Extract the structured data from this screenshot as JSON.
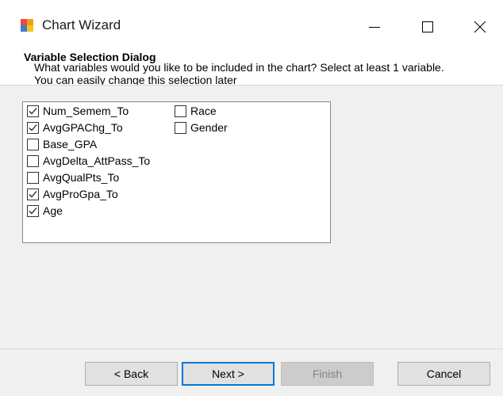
{
  "window": {
    "title": "Chart Wizard",
    "icons": {
      "app": "chart-app-icon",
      "minimize": "minimize-icon",
      "maximize": "maximize-icon",
      "close": "close-icon"
    }
  },
  "header": {
    "title": "Variable Selection Dialog",
    "description": "What variables would you like to be included in the chart? Select at least 1 variable. You can easily change this selection later"
  },
  "variables": {
    "column1": [
      {
        "label": "Num_Semem_To",
        "checked": true
      },
      {
        "label": "AvgGPAChg_To",
        "checked": true
      },
      {
        "label": "Base_GPA",
        "checked": false
      },
      {
        "label": "AvgDelta_AttPass_To",
        "checked": false
      },
      {
        "label": "AvgQualPts_To",
        "checked": false
      },
      {
        "label": "AvgProGpa_To",
        "checked": true
      },
      {
        "label": "Age",
        "checked": true
      }
    ],
    "column2": [
      {
        "label": "Race",
        "checked": false
      },
      {
        "label": "Gender",
        "checked": false
      }
    ]
  },
  "buttons": {
    "back": "< Back",
    "next": "Next >",
    "finish": "Finish",
    "cancel": "Cancel",
    "finish_enabled": false,
    "default_button": "next"
  },
  "colors": {
    "accent": "#0078d7",
    "dialog_bg": "#f0f0f0"
  }
}
